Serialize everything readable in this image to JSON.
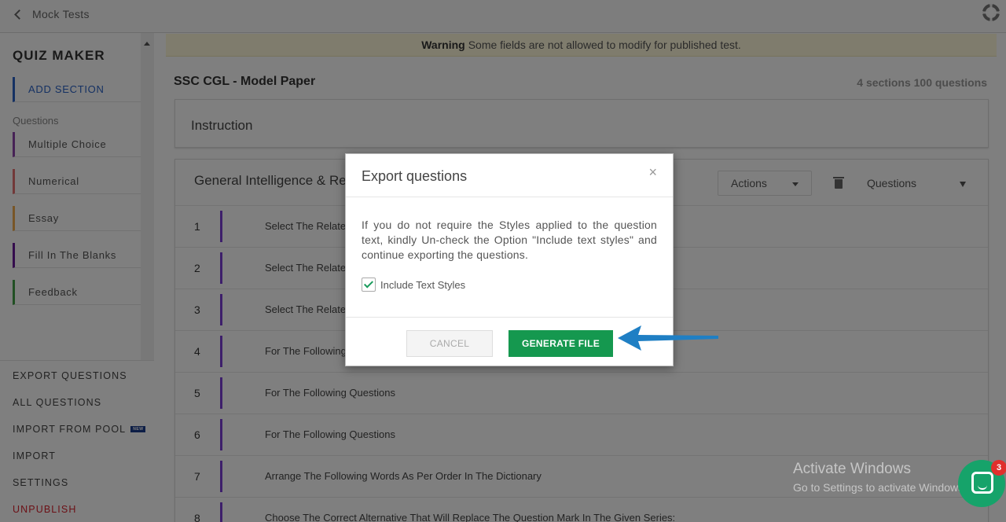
{
  "topbar": {
    "back_label": "Mock Tests"
  },
  "sidebar": {
    "title": "QUIZ MAKER",
    "add_section": "ADD SECTION",
    "questions_label": "Questions",
    "question_types": [
      {
        "label": "Multiple Choice",
        "color": "#8e44ad"
      },
      {
        "label": "Numerical",
        "color": "#e57373"
      },
      {
        "label": "Essay",
        "color": "#f0ad4e"
      },
      {
        "label": "Fill In The Blanks",
        "color": "#6a1b9a"
      },
      {
        "label": "Feedback",
        "color": "#43a047"
      }
    ],
    "links": {
      "export": "EXPORT QUESTIONS",
      "all": "ALL QUESTIONS",
      "import_pool": "IMPORT FROM POOL",
      "import_pool_badge": "NEW",
      "import": "IMPORT",
      "settings": "SETTINGS",
      "unpublish": "UNPUBLISH"
    }
  },
  "warning": {
    "strong": "Warning",
    "text": "Some fields are not allowed to modify for published test."
  },
  "test": {
    "title": "SSC CGL - Model Paper",
    "meta": "4 sections 100 questions"
  },
  "instruction_label": "Instruction",
  "section": {
    "name": "General Intelligence & Rea",
    "actions_label": "Actions",
    "questions_select": "Questions"
  },
  "questions": [
    {
      "num": "1",
      "text": "Select The Relate"
    },
    {
      "num": "2",
      "text": "Select The Relate"
    },
    {
      "num": "3",
      "text": "Select The Relate"
    },
    {
      "num": "4",
      "text": "For The Following"
    },
    {
      "num": "5",
      "text": "For The Following Questions"
    },
    {
      "num": "6",
      "text": "For The Following Questions"
    },
    {
      "num": "7",
      "text": "Arrange The Following Words As Per Order In The Dictionary"
    },
    {
      "num": "8",
      "text": "Choose The Correct Alternative That Will Replace The Question Mark In The Given Series:"
    }
  ],
  "modal": {
    "title": "Export questions",
    "close": "×",
    "message": "If you do not require the Styles applied to the question text, kindly Un-check the Option \"Include text styles\" and continue exporting the questions.",
    "checkbox_label": "Include Text Styles",
    "checkbox_checked": true,
    "cancel": "CANCEL",
    "generate": "GENERATE FILE"
  },
  "watermark": {
    "line1": "Activate Windows",
    "line2": "Go to Settings to activate Windows."
  },
  "chat": {
    "badge": "3"
  },
  "colors": {
    "accent_blue": "#2a63c6",
    "generate_green": "#15984f",
    "question_bar": "#7b3fd6",
    "danger": "#d8202c",
    "arrow": "#1f7fc4"
  }
}
